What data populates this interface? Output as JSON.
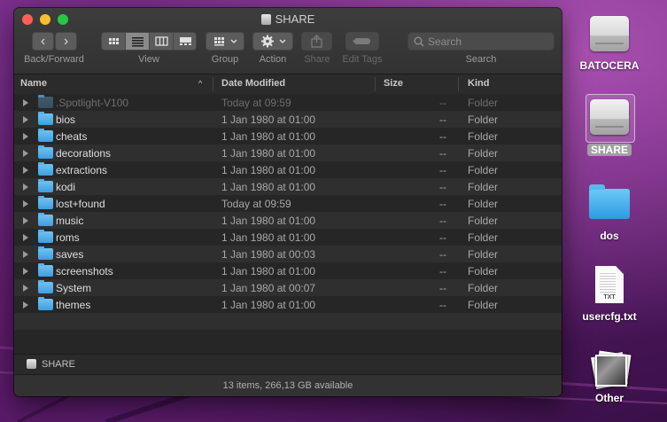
{
  "window": {
    "title": "SHARE",
    "toolbar": {
      "nav_label": "Back/Forward",
      "back_glyph": "‹",
      "forward_glyph": "›",
      "view_label": "View",
      "group_label": "Group",
      "action_label": "Action",
      "share_label": "Share",
      "edit_tags_label": "Edit Tags",
      "search_label": "Search",
      "search_placeholder": "Search",
      "active_view": "list"
    },
    "columns": {
      "name": "Name",
      "date": "Date Modified",
      "size": "Size",
      "kind": "Kind"
    },
    "rows": [
      {
        "name": ".Spotlight-V100",
        "date": "Today at 09:59",
        "size": "--",
        "kind": "Folder",
        "muted": true
      },
      {
        "name": "bios",
        "date": "1 Jan 1980 at 01:00",
        "size": "--",
        "kind": "Folder"
      },
      {
        "name": "cheats",
        "date": "1 Jan 1980 at 01:00",
        "size": "--",
        "kind": "Folder"
      },
      {
        "name": "decorations",
        "date": "1 Jan 1980 at 01:00",
        "size": "--",
        "kind": "Folder"
      },
      {
        "name": "extractions",
        "date": "1 Jan 1980 at 01:00",
        "size": "--",
        "kind": "Folder"
      },
      {
        "name": "kodi",
        "date": "1 Jan 1980 at 01:00",
        "size": "--",
        "kind": "Folder"
      },
      {
        "name": "lost+found",
        "date": "Today at 09:59",
        "size": "--",
        "kind": "Folder"
      },
      {
        "name": "music",
        "date": "1 Jan 1980 at 01:00",
        "size": "--",
        "kind": "Folder"
      },
      {
        "name": "roms",
        "date": "1 Jan 1980 at 01:00",
        "size": "--",
        "kind": "Folder"
      },
      {
        "name": "saves",
        "date": "1 Jan 1980 at 00:03",
        "size": "--",
        "kind": "Folder"
      },
      {
        "name": "screenshots",
        "date": "1 Jan 1980 at 01:00",
        "size": "--",
        "kind": "Folder"
      },
      {
        "name": "System",
        "date": "1 Jan 1980 at 00:07",
        "size": "--",
        "kind": "Folder"
      },
      {
        "name": "themes",
        "date": "1 Jan 1980 at 01:00",
        "size": "--",
        "kind": "Folder"
      }
    ],
    "path_bar": "SHARE",
    "status": "13 items, 266,13 GB available"
  },
  "desktop": {
    "icons": [
      {
        "label": "BATOCERA",
        "icon": "drive-icon"
      },
      {
        "label": "SHARE",
        "icon": "drive-icon",
        "selected": true
      },
      {
        "label": "dos",
        "icon": "folder-icon"
      },
      {
        "label": "usercfg.txt",
        "icon": "text-file-icon",
        "ext": "TXT"
      },
      {
        "label": "Other",
        "icon": "image-stack-icon"
      }
    ]
  },
  "colors": {
    "close": "#fe5f57",
    "minimize": "#febc2e",
    "zoom": "#28c840",
    "folder": "#4aa8e8",
    "window_bg": "#262626"
  }
}
